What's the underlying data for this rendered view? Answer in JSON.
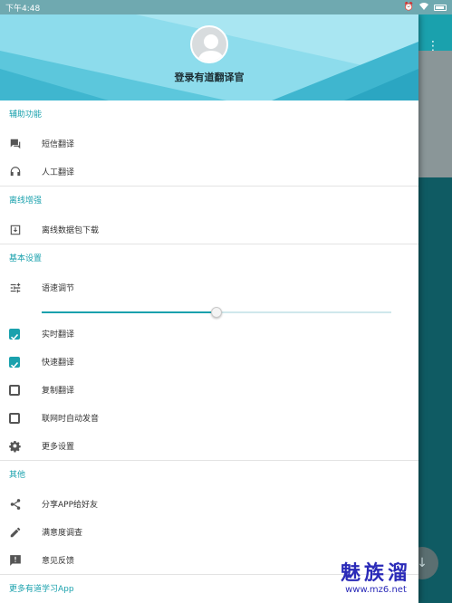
{
  "status_bar": {
    "time": "下午4:48"
  },
  "header": {
    "login_label": "登录有道翻译官"
  },
  "sections": [
    {
      "title": "辅助功能",
      "items": [
        {
          "label": "短信翻译",
          "icon": "chat-icon"
        },
        {
          "label": "人工翻译",
          "icon": "headset-icon"
        }
      ]
    },
    {
      "title": "离线增强",
      "items": [
        {
          "label": "离线数据包下载",
          "icon": "download-box-icon"
        }
      ]
    },
    {
      "title": "基本设置",
      "items": [
        {
          "label": "语速调节",
          "icon": "tune-icon"
        },
        {
          "label": "实时翻译",
          "icon": "checkbox",
          "checked": true
        },
        {
          "label": "快速翻译",
          "icon": "checkbox",
          "checked": true
        },
        {
          "label": "复制翻译",
          "icon": "checkbox",
          "checked": false
        },
        {
          "label": "联网时自动发音",
          "icon": "checkbox",
          "checked": false
        },
        {
          "label": "更多设置",
          "icon": "gear-icon"
        }
      ],
      "speed_slider": {
        "value": 0.5
      }
    },
    {
      "title": "其他",
      "items": [
        {
          "label": "分享APP给好友",
          "icon": "share-icon"
        },
        {
          "label": "满意度调查",
          "icon": "pencil-icon"
        },
        {
          "label": "意见反馈",
          "icon": "feedback-icon"
        }
      ]
    },
    {
      "title": "更多有道学习App",
      "items": []
    }
  ],
  "watermark": {
    "top": "魅族溜",
    "bottom": "www.mz6.net"
  },
  "colors": {
    "accent": "#1aa1ad",
    "header_bg": "#8ddcec",
    "background_app": "#0f5b63"
  }
}
